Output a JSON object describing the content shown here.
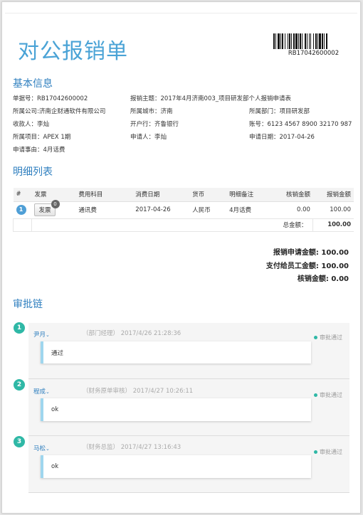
{
  "doc": {
    "title": "对公报销单",
    "barcode_text": "RB17042600002"
  },
  "basic": {
    "heading": "基本信息",
    "fields": {
      "doc_no": "单据号：RB17042600002",
      "subject": "报销主题：2017年4月济南003_项目研发部个人报销申请表",
      "company": "所属公司:济南企财通软件有限公司",
      "city": "所属城市：济南",
      "department": "所属部门：项目研发部",
      "payee": "收款人：李灿",
      "bank": "开户行：齐鲁银行",
      "account": "账号：6123 4567 8900 32170 987",
      "project": "所属项目：APEX 1期",
      "applicant": "申请人：李灿",
      "apply_date": "申请日期：2017-04-26",
      "reason": "申请事由：4月话费"
    }
  },
  "detail": {
    "heading": "明细列表",
    "columns": [
      "#",
      "发票",
      "费用科目",
      "消费日期",
      "货币",
      "明细备注",
      "核销金额",
      "报销金额"
    ],
    "rows": [
      {
        "index": "1",
        "invoice_button": "发票",
        "invoice_count": "0",
        "category": "通讯费",
        "date": "2017-04-26",
        "currency": "人民币",
        "note": "4月话费",
        "writeoff": "0.00",
        "amount": "100.00"
      }
    ],
    "total_label": "总金额：",
    "total_value": "100.00"
  },
  "summary": {
    "apply_amount": "报销申请金额: 100.00",
    "pay_amount": "支付给员工金额: 100.00",
    "writeoff_amount": "核销金额: 0.00"
  },
  "approval": {
    "heading": "审批链",
    "steps": [
      {
        "num": "1",
        "name": "尹月",
        "role": "（部门经理）",
        "time": "2017/4/26 21:28:36",
        "status": "审批通过",
        "comment": "通过"
      },
      {
        "num": "2",
        "name": "程成",
        "role": "（财务原单审核）",
        "time": "2017/4/27 10:26:11",
        "status": "审批通过",
        "comment": "ok"
      },
      {
        "num": "3",
        "name": "马松",
        "role": "（财务总监）",
        "time": "2017/4/27 13:16:43",
        "status": "审批通过",
        "comment": "ok"
      }
    ]
  },
  "colors": {
    "title_blue": "#4aa3d6",
    "heading_blue": "#2f7fbf",
    "step_teal": "#2fb8a6",
    "comment_accent": "#9fd6ee"
  }
}
